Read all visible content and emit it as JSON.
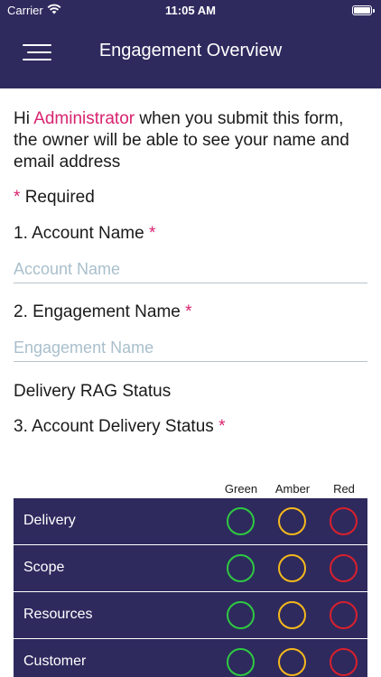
{
  "status_bar": {
    "carrier": "Carrier",
    "time": "11:05 AM"
  },
  "nav": {
    "title": "Engagement Overview"
  },
  "intro": {
    "greeting": "Hi ",
    "user": "Administrator",
    "message": "  when you submit this form, the owner will be able to see your name and email address"
  },
  "required_note": {
    "star": "*",
    "label": "Required"
  },
  "questions": [
    {
      "label": "1. Account Name",
      "required_star": "*",
      "placeholder": "Account Name",
      "value": ""
    },
    {
      "label": "2. Engagement Name",
      "required_star": "*",
      "placeholder": "Engagement Name",
      "value": ""
    }
  ],
  "section_title": "Delivery RAG Status",
  "rag_question": {
    "label": "3. Account Delivery Status",
    "required_star": "*"
  },
  "rag_columns": [
    "Green",
    "Amber",
    "Red"
  ],
  "rag_rows": [
    "Delivery",
    "Scope",
    "Resources",
    "Customer"
  ],
  "colors": {
    "brand": "#2e2a5e",
    "accent": "#d8236f",
    "green": "#2ec940",
    "amber": "#f5b81c",
    "red": "#d9202c"
  }
}
